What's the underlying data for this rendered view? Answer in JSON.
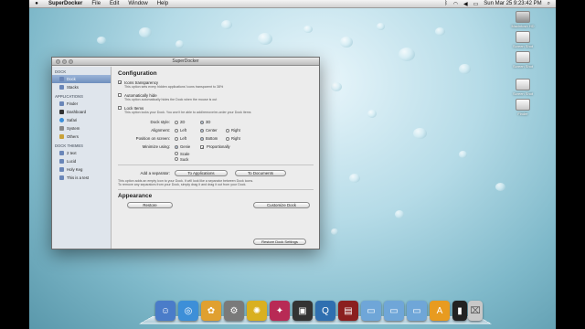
{
  "menubar": {
    "app": "SuperDocker",
    "items": [
      "File",
      "Edit",
      "Window",
      "Help"
    ],
    "clock": "Sun Mar 25  9:23:42 PM"
  },
  "desktop_icons": [
    "Macintosh HD",
    "Screen Shot",
    "Screen Shot",
    "Screen Shot",
    "Screen Shot",
    "Finder"
  ],
  "window": {
    "title": "SuperDocker",
    "sidebar": {
      "sections": [
        {
          "header": "DOCK",
          "items": [
            "Dock",
            "Stacks"
          ]
        },
        {
          "header": "APPLICATIONS",
          "items": [
            "Finder",
            "Dashboard",
            "Safari",
            "System",
            "Others"
          ]
        },
        {
          "header": "DOCK THEMES",
          "items": [
            "2 text",
            "Lucid",
            "Holy Keg",
            "This is a test"
          ]
        }
      ]
    },
    "configuration": {
      "title": "Configuration",
      "icons_transparency": {
        "label": "Icons transparency",
        "checked": true,
        "desc": "This option sets every hidden applications' icons transparent to 38%"
      },
      "automatically_hide": {
        "label": "Automatically hide",
        "checked": false,
        "desc": "This option automatically hides the Dock when the mouse is out"
      },
      "lock_items": {
        "label": "Lock Items",
        "checked": false,
        "desc": "This option locks your Dock. You won't be able to add/remove/re-order your Dock items"
      },
      "dock_style": {
        "label": "Dock style:",
        "options": [
          "2D",
          "3D"
        ],
        "selected": "3D"
      },
      "alignment": {
        "label": "Alignment:",
        "options": [
          "Left",
          "Center",
          "Right"
        ],
        "selected": "Center"
      },
      "position": {
        "label": "Position on screen:",
        "options": [
          "Left",
          "Bottom",
          "Right"
        ],
        "selected": "Bottom"
      },
      "minimize": {
        "label": "Minimize using:",
        "options": [
          "Genie",
          "Proportionally",
          "Scale",
          "Suck"
        ],
        "selected": "Genie"
      },
      "separator": {
        "label": "Add a separator:",
        "btn_apps": "To Applications",
        "btn_docs": "To Documents",
        "desc1": "This option adds an empty icon to your Dock. It will look like a separator between Dock icons.",
        "desc2": "To remove any separators from your Dock, simply drag it and drag it out from your Dock."
      }
    },
    "appearance": {
      "title": "Appearance",
      "restore_label": "Restore",
      "customize_label": "Customize Dock"
    },
    "footer": {
      "restore_settings": "Restore Dock Settings"
    }
  },
  "dock_icons": [
    {
      "name": "finder-icon",
      "color": "#4a7cc9",
      "glyph": "☺"
    },
    {
      "name": "safari-icon",
      "color": "#3d8fd8",
      "glyph": "◎"
    },
    {
      "name": "photos-icon",
      "color": "#e0a030",
      "glyph": "✿"
    },
    {
      "name": "settings-icon",
      "color": "#7a7a7a",
      "glyph": "⚙"
    },
    {
      "name": "sunflower-icon",
      "color": "#d9b020",
      "glyph": "✺"
    },
    {
      "name": "app-icon",
      "color": "#b82a55",
      "glyph": "✦"
    },
    {
      "name": "screen-icon",
      "color": "#333333",
      "glyph": "▣"
    },
    {
      "name": "quicktime-icon",
      "color": "#2f6fb0",
      "glyph": "Q"
    },
    {
      "name": "book-icon",
      "color": "#8b1f1f",
      "glyph": "▤"
    },
    {
      "name": "folder-icon",
      "color": "#6fa6d8",
      "glyph": "▭"
    },
    {
      "name": "folder-icon-2",
      "color": "#6fa6d8",
      "glyph": "▭"
    },
    {
      "name": "folder-icon-3",
      "color": "#5a94cf",
      "glyph": "▭"
    },
    {
      "name": "appstore-icon",
      "color": "#e89b20",
      "glyph": "A"
    },
    {
      "name": "document-icon",
      "color": "#d8d8d8",
      "glyph": "▯"
    },
    {
      "name": "terminal-icon",
      "color": "#222222",
      "glyph": "▮"
    },
    {
      "name": "trash-icon",
      "color": "#c8c8c8",
      "glyph": "⌧"
    }
  ]
}
